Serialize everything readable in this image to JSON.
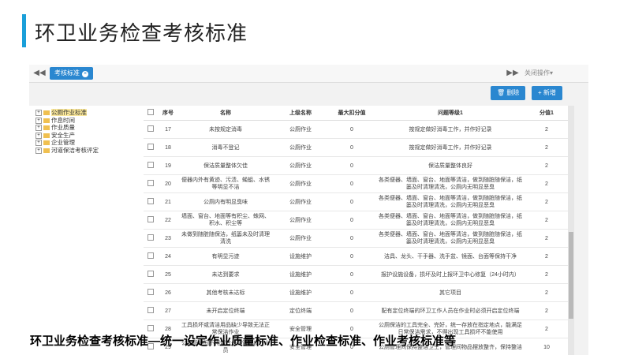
{
  "slide": {
    "title": "环卫业务检查考核标准",
    "caption": "环卫业务检查考核标准—统一设定作业质量标准、作业检查标准、作业考核标准等"
  },
  "tabs": {
    "prev": "◀◀",
    "active_label": "考核标准",
    "close": "×",
    "next": "▶▶",
    "ops_label": "关闭操作▾"
  },
  "toolbar": {
    "delete_label": "🗑 删除",
    "add_label": "+ 新增"
  },
  "tree": [
    {
      "pm": "+",
      "label": "公厕作业标准",
      "selected": true
    },
    {
      "pm": "+",
      "label": "作息时间"
    },
    {
      "pm": "+",
      "label": "作业质量"
    },
    {
      "pm": "+",
      "label": "安全生产"
    },
    {
      "pm": "+",
      "label": "企业管理"
    },
    {
      "pm": "+",
      "label": "河道保洁考核评定"
    }
  ],
  "table": {
    "headers": [
      "",
      "序号",
      "名称",
      "上级名称",
      "最大扣分值",
      "问题等级1",
      "分值1"
    ],
    "rows": [
      [
        "17",
        "未按规定消毒",
        "公厕作业",
        "0",
        "按规定做好消毒工作，并作好记录",
        "2"
      ],
      [
        "18",
        "消毒不登记",
        "公厕作业",
        "0",
        "按规定做好消毒工作，并作好记录",
        "2"
      ],
      [
        "19",
        "保洁质量整体欠佳",
        "公厕作业",
        "0",
        "保洁质量整体良好",
        "2"
      ],
      [
        "20",
        "便器内外有黄迹、污渍、蝇蛆、水锈等明显不洁",
        "公厕作业",
        "0",
        "各类便器、墙面、窗台、地面等清洁，做到随脏随保洁，纸篓及时清理清洗，公厕内无明显恶臭",
        "2"
      ],
      [
        "21",
        "公厕内有明显臭味",
        "公厕作业",
        "0",
        "各类便器、墙面、窗台、地面等清洁，做到随脏随保洁，纸篓及时清理清洗，公厕内无明显恶臭",
        "2"
      ],
      [
        "22",
        "墙面、窗台、地面等有积尘、蛛网、积水、积尘等",
        "公厕作业",
        "0",
        "各类便器、墙面、窗台、地面等清洁，做到随脏随保洁，纸篓及时清理清洗，公厕内无明显恶臭",
        "2"
      ],
      [
        "23",
        "未做到随脏随保洁，纸篓未及时清理清洗",
        "公厕作业",
        "0",
        "各类便器、墙面、窗台、地面等清洁，做到随脏随保洁，纸篓及时清理清洗，公厕内无明显恶臭",
        "2"
      ],
      [
        "24",
        "有明显污迹",
        "设施维护",
        "0",
        "洁具、龙头、干手器、洗手盆、镜面、台面等保持干净",
        "2"
      ],
      [
        "25",
        "未达到要求",
        "设施维护",
        "0",
        "报护设施设备，损坏及时上报环卫中心修复（24小时内）",
        "2"
      ],
      [
        "26",
        "其他考核未达标",
        "设施维护",
        "0",
        "其它项目",
        "2"
      ],
      [
        "27",
        "未开启定位终端",
        "定位终端",
        "0",
        "配有定位终端的环卫工作人员在作业时必须开启定位终端",
        "2"
      ],
      [
        "28",
        "工具损坏或清洁用品缺少导致无法正常保洁作业",
        "安全管理",
        "0",
        "公厕保洁的工具完全、完好，统一存放在指定地点，能满足日常保洁需求，不得出现工具损坏不能使用",
        "2"
      ],
      [
        "29",
        "公厕管理间不得留有公厕管理以外人员",
        "安全管理",
        "0",
        "公厕管理间保持整洁卫生，管理间物品摆放整齐，保持整洁",
        "10"
      ]
    ]
  }
}
